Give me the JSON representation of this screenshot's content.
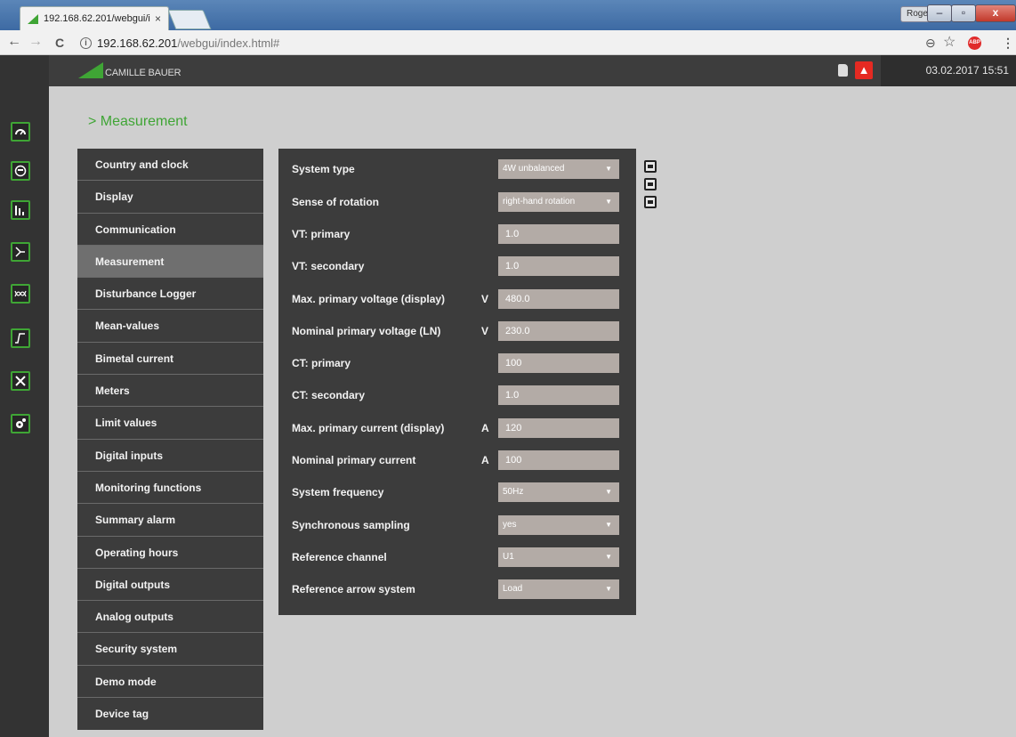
{
  "browser": {
    "tab_title": "192.168.62.201/webgui/i",
    "tab_close": "×",
    "user": "Roger",
    "min": "–",
    "max": "▫",
    "close": "x",
    "url_host": "192.168.62.201",
    "url_path": "/webgui/index.html#",
    "back": "←",
    "forward": "→",
    "reload": "C",
    "zoom": "⊖",
    "star": "☆",
    "abp": "ABP",
    "menu": "⋮"
  },
  "header": {
    "brand": "CAMILLE BAUER",
    "datetime": "03.02.2017  15:51"
  },
  "page_title": "> Measurement",
  "menu": [
    {
      "label": "Country and clock"
    },
    {
      "label": "Display"
    },
    {
      "label": "Communication"
    },
    {
      "label": "Measurement"
    },
    {
      "label": "Disturbance Logger"
    },
    {
      "label": "Mean-values"
    },
    {
      "label": "Bimetal current"
    },
    {
      "label": "Meters"
    },
    {
      "label": "Limit values"
    },
    {
      "label": "Digital inputs"
    },
    {
      "label": "Monitoring functions"
    },
    {
      "label": "Summary alarm"
    },
    {
      "label": "Operating hours"
    },
    {
      "label": "Digital outputs"
    },
    {
      "label": "Analog outputs"
    },
    {
      "label": "Security system"
    },
    {
      "label": "Demo mode"
    },
    {
      "label": "Device tag"
    }
  ],
  "form": [
    {
      "label": "System type",
      "unit": "",
      "value": "4W unbalanced"
    },
    {
      "label": "Sense of rotation",
      "unit": "",
      "value": "right-hand rotation"
    },
    {
      "label": "VT: primary",
      "unit": "",
      "value": "1.0"
    },
    {
      "label": "VT: secondary",
      "unit": "",
      "value": "1.0"
    },
    {
      "label": "Max. primary voltage (display)",
      "unit": "V",
      "value": "480.0"
    },
    {
      "label": "Nominal primary voltage (LN)",
      "unit": "V",
      "value": "230.0"
    },
    {
      "label": "CT: primary",
      "unit": "",
      "value": "100"
    },
    {
      "label": "CT: secondary",
      "unit": "",
      "value": "1.0"
    },
    {
      "label": "Max. primary current (display)",
      "unit": "A",
      "value": "120"
    },
    {
      "label": "Nominal primary current",
      "unit": "A",
      "value": "100"
    },
    {
      "label": "System frequency",
      "unit": "",
      "value": "50Hz"
    },
    {
      "label": "Synchronous sampling",
      "unit": "",
      "value": "yes"
    },
    {
      "label": "Reference channel",
      "unit": "",
      "value": "U1"
    },
    {
      "label": "Reference arrow system",
      "unit": "",
      "value": "Load"
    }
  ],
  "caret": "▼",
  "colors": {
    "accent": "#3fa535",
    "alarm": "#e52a22",
    "panel": "#3c3c3c",
    "field": "#b3aba6"
  }
}
